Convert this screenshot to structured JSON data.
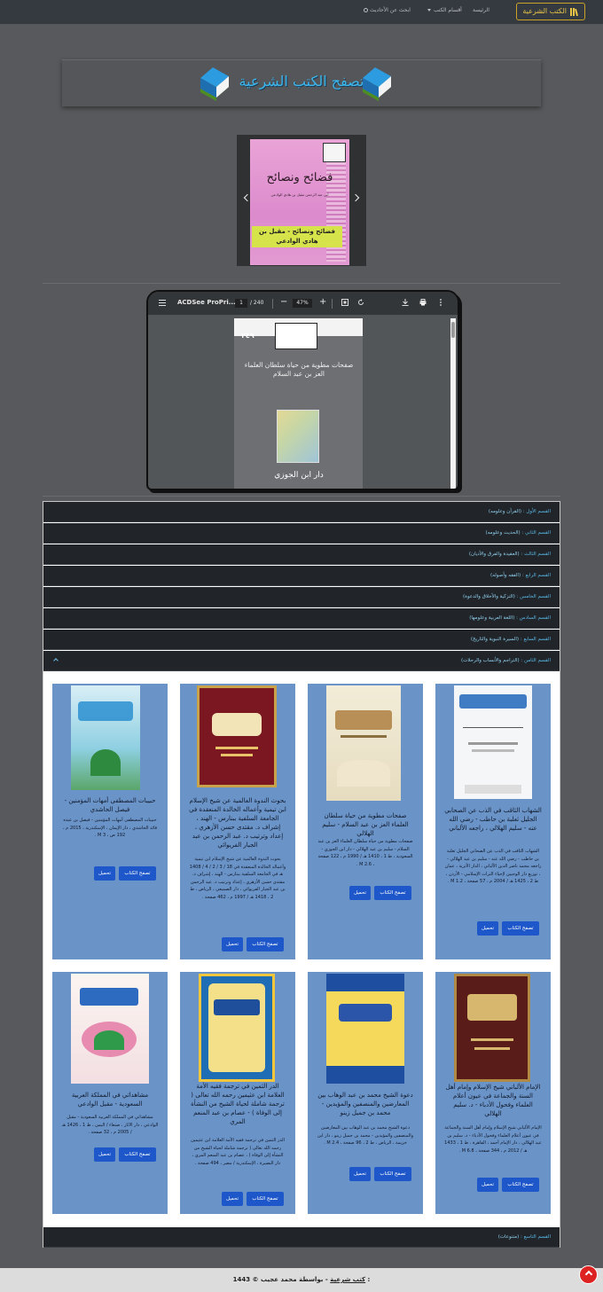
{
  "navbar": {
    "brand": "الكتب الشرعية",
    "home": "الرئيسة",
    "books_menu": "أقسام الكتب",
    "search": "ابحث عن الأحاديث"
  },
  "banner": {
    "title": "تصفح الكتب الشرعية"
  },
  "carousel": {
    "book_title": "فضائح ونصائح",
    "book_author": "أبي عبد الرحمن مقبل بن هادي الوادعي",
    "caption": "فضائح ونصائح - مقبل بن هادي الوادعي"
  },
  "pdf_viewer": {
    "file_name": "ACDSee ProPri...",
    "page_current": "1",
    "page_total": "/ 240",
    "zoom": "47%",
    "page_number": "٢٤٩",
    "page_title": "صفحات مطوية من حياة سلطان العلماء العز بن عبد السلام",
    "publisher": "دار ابن الجوزي"
  },
  "sections": [
    {
      "prefix": "القسم الأول :",
      "name": "(القرآن وعلومه)"
    },
    {
      "prefix": "القسم الثاني :",
      "name": "(الحديث وعلومه)"
    },
    {
      "prefix": "القسم الثالث :",
      "name": "(العقيدة والفرق والأديان)"
    },
    {
      "prefix": "القسم الرابع :",
      "name": "(الفقه وأصوله)"
    },
    {
      "prefix": "القسم الخامس :",
      "name": "(التزكية والأخلاق والدعوة)"
    },
    {
      "prefix": "القسم السادس :",
      "name": "(اللغة العربية وعلومها)"
    },
    {
      "prefix": "القسم السابع :",
      "name": "(السيرة النبوية والتاريخ)"
    },
    {
      "prefix": "القسم الثامن :",
      "name": "(التراجم والأنساب والرحلات)"
    },
    {
      "prefix": "القسم التاسع :",
      "name": "(متنوعات)"
    }
  ],
  "buttons": {
    "browse": "تصفح الكتاب",
    "download": "تحميل"
  },
  "books": [
    {
      "title": "الشهاب الثاقب في الذب عن الصحابي الجليل ثعلبة بن حاطب - رضي الله عنه - سليم الهلالي ، راجعه الألباني",
      "desc": "الشهاب الثاقب في الذب عن الصحابي الجليل ثعلبة بن حاطب - رضي الله عنه - سليم بن عيد الهلالي - راجعه محمد ناصر الدين الألباني ، الدار الأثرية ، عمان ، توزيع دار الوحيين لإحياء التراث الإسلامي - الأردن ، ط 2 ، 1425 هـ / 2004 م ، 57 صفحة ، M 1.2 ."
    },
    {
      "title": "صفحات مطوية من حياة سلطان العلماء العز بن عبد السلام - سليم الهلالي",
      "desc": "صفحات مطوية من حياة سلطان العلماء العز بن عبد السلام - سليم بن عيد الهلالي - دار ابن الجوزي - السعودية ، ط 1 ، 1410 هـ / 1990 م ، 122 صفحة ، M 2.6 ."
    },
    {
      "title": "بحوث الندوة العالمية عن شيخ الإسلام ابن تيمية وأعماله الخالدة المنعقدة في الجامعة السلفية ببنارس - الهند ، إشراف د. مقتدى حسن الأزهري ، إعداد وترتيب د. عبد الرحمن بن عبد الجبار الفريوائي",
      "desc": "بحوث الندوة العالمية عن شيخ الإسلام ابن تيمية وأعماله الخالدة المنعقدة في 18 / 3 / 2 / 4 / 1408 هـ في الجامعة السلفية ببنارس - الهند ، إشراف د. مقتدى حسن الأزهري ، إعداد وترتيب د. عبد الرحمن بن عبد الجبار الفريوائي ، دار الصميعي ، الرياض ، ط 2 ، 1418 هـ / 1997 م ، 462 صفحة ."
    },
    {
      "title": "حبيبات المصطفى أمهات المؤمنين - فيصل الحاشدي",
      "desc": "حبيبات المصطفى أمهات المؤمنين - فيصل بن عبده قائد الحاشدي ، دار الإيمان ، الإسكندرية ، 2015 م ، 192 ص ، M 3 ."
    },
    {
      "title": "الإمام الألباني شيخ الإسلام وإمام أهل السنة والجماعة في عيون أعلام العلماء وفحول الأدباء - د. سليم الهلالي",
      "desc": "الإمام الألباني شيخ الإسلام وإمام أهل السنة والجماعة في عيون أعلام العلماء وفحول الأدباء - د. سليم بن عيد الهلالي ، دار الإمام أحمد ، القاهرة ، ط 1 ، 1433 هـ / 2012 م ، 344 صفحة ، M 6.8 ."
    },
    {
      "title": "دعوة الشيخ محمد بن عبد الوهاب بين المعارضين والمنصفين والمؤيدين - محمد بن جميل زينو",
      "desc": "دعوة الشيخ محمد بن عبد الوهاب بين المعارضين والمنصفين والمؤيدين - محمد بن جميل زينو ، دار ابن خزيمة ، الرياض ، ط 2 ، 96 صفحة ، M 2.4 ."
    },
    {
      "title": "الدر الثمين في ترجمة فقيه الأمة العلامة ابن عثيمين رحمه الله تعالى ( ترجمة شاملة لحياة الشيخ من النشأة إلى الوفاة ) - عصام بن عبد المنعم المري",
      "desc": "الدر الثمين في ترجمة فقيه الأمة العلامة ابن عثيمين رحمه الله تعالى ( ترجمة شاملة لحياة الشيخ من النشأة إلى الوفاة ) ، عصام بن عبد المنعم المري ، دار البصيرة ، الإسكندرية / مصر ، 494 صفحة ."
    },
    {
      "title": "مشاهداتي في المملكة العربية السعودية - مقبل الوادعي",
      "desc": "مشاهداتي في المملكة العربية السعودية - مقبل الوادعي ، دار الآثار ، صنعاء / اليمن ، ط 1 ، 1426 هـ / 2005 م ، 32 صفحة ."
    }
  ],
  "footer": {
    "copyright": "© 1443 :",
    "site": "كتب شرعية",
    "by": "- بواسطة محمد عجيب"
  }
}
